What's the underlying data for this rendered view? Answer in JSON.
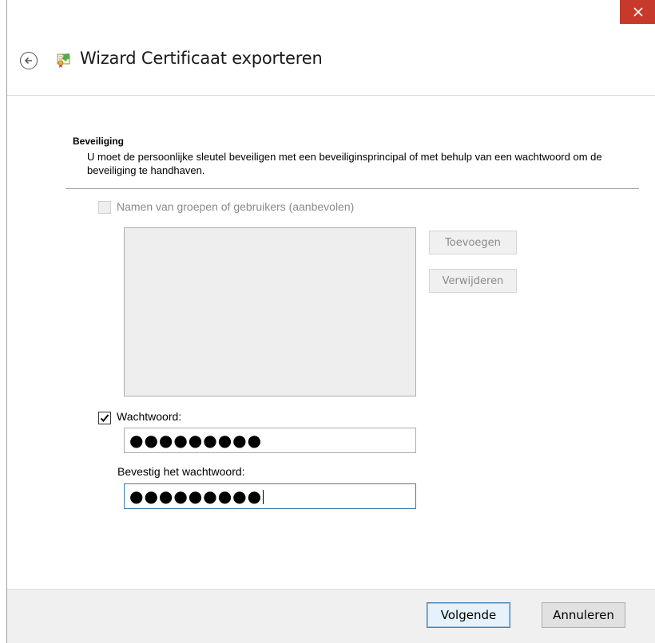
{
  "window": {
    "title": "Wizard Certificaat exporteren",
    "close_icon": "close-icon",
    "back_icon": "back-arrow-icon",
    "cert_icon": "certificate-icon",
    "close_color": "#c7392b"
  },
  "section": {
    "title": "Beveiliging",
    "description": "U moet de persoonlijke sleutel beveiligen met een beveiliginsprincipal of met behulp van een wachtwoord om de beveiliging te handhaven."
  },
  "groups": {
    "checkbox_label": "Namen van groepen of gebruikers (aanbevolen)",
    "checked": false,
    "enabled": false,
    "items": [],
    "add_label": "Toevoegen",
    "remove_label": "Verwijderen"
  },
  "password": {
    "checkbox_label": "Wachtwoord:",
    "checked": true,
    "value_masked": "●●●●●●●●●",
    "confirm_label": "Bevestig het wachtwoord:",
    "confirm_value_masked": "●●●●●●●●●"
  },
  "footer": {
    "next_label": "Volgende",
    "cancel_label": "Annuleren"
  }
}
